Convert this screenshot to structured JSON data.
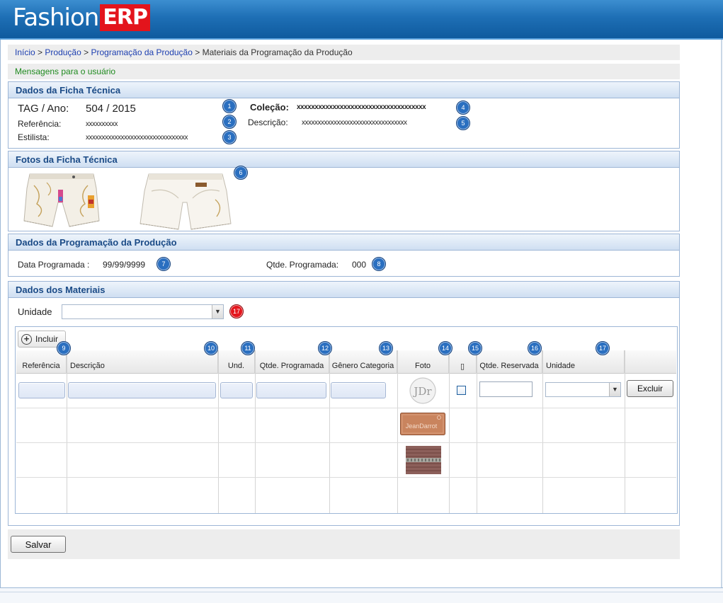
{
  "app": {
    "logo_part1": "Fashion",
    "logo_part2": "ERP"
  },
  "breadcrumb": {
    "items": [
      "Início",
      "Produção",
      "Programação da Produção"
    ],
    "separator": ">",
    "current": "Materiais da Programação da Produção"
  },
  "messages": {
    "text": "Mensagens para o usuário"
  },
  "ficha": {
    "title": "Dados da Ficha Técnica",
    "tag_label": "TAG / Ano:",
    "tag_value": "504 / 2015",
    "referencia_label": "Referência:",
    "referencia_value": "xxxxxxxxxx",
    "estilista_label": "Estilista:",
    "estilista_value": "xxxxxxxxxxxxxxxxxxxxxxxxxxxxxxxx",
    "colecao_label": "Coleção:",
    "colecao_value": "xxxxxxxxxxxxxxxxxxxxxxxxxxxxxxxxxxxx",
    "descricao_label": "Descrição:",
    "descricao_value": "xxxxxxxxxxxxxxxxxxxxxxxxxxxxxxxxx"
  },
  "fotos": {
    "title": "Fotos da Ficha Técnica"
  },
  "programacao": {
    "title": "Dados da Programação da Produção",
    "data_label": "Data Programada :",
    "data_value": "99/99/9999",
    "qtde_label": "Qtde. Programada:",
    "qtde_value": "000"
  },
  "materiais": {
    "title": "Dados dos Materiais",
    "unidade_label": "Unidade",
    "unidade_selected": "",
    "incluir_label": "Incluir",
    "columns": [
      "Referência",
      "Descrição",
      "Und.",
      "Qtde. Programada",
      "Gênero Categoria",
      "Foto",
      "▯",
      "Qtde. Reservada",
      "Unidade",
      ""
    ],
    "excluir_label": "Excluir",
    "foto_labels": [
      "JDr",
      "JeanDarrot"
    ]
  },
  "markers": [
    "1",
    "2",
    "3",
    "4",
    "5",
    "6",
    "7",
    "8",
    "9",
    "10",
    "11",
    "12",
    "13",
    "14",
    "15",
    "16",
    "17",
    "17"
  ],
  "footer": {
    "salvar_label": "Salvar"
  }
}
